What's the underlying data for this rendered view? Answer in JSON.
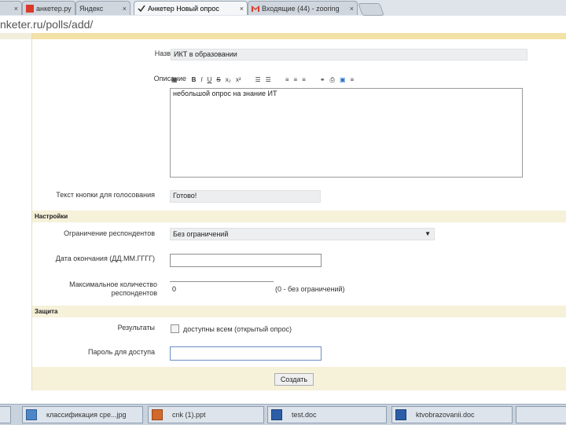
{
  "browser": {
    "tabs": [
      {
        "label": "анкетер.ру",
        "active": false
      },
      {
        "label": "Яндекс",
        "active": false
      },
      {
        "label": "Анкетер   Новый опрос",
        "active": true
      },
      {
        "label": "Входящие (44) - zooring",
        "active": false
      }
    ],
    "close_glyph": "×",
    "address": "nketer.ru/polls/add/"
  },
  "form": {
    "name_label": "Название",
    "name_value": "ИКТ в образовании",
    "description_label": "Описание",
    "toolbar": [
      "▦",
      "B",
      "I",
      "U",
      "S",
      "x₂",
      "x²",
      "☰",
      "☰",
      "≡",
      "≡",
      "≡",
      "⚭",
      "⎙",
      "▣",
      "≡"
    ],
    "description_value": "небольшой опрос на знание ИТ",
    "vote_button_label": "Текст кнопки для голосования",
    "vote_button_value": "Готово!",
    "settings_header": "Настройки",
    "restriction_label": "Ограничение респондентов",
    "restriction_value": "Без ограничений",
    "end_date_label": "Дата окончания (ДД.ММ.ГГГГ)",
    "end_date_value": "",
    "max_label": "Максимальное количество респондентов",
    "max_value": "0",
    "max_hint": "(0 - без ограничений)",
    "protection_header": "Защита",
    "results_label": "Результаты",
    "results_checkbox_label": "доступны всем (открытый опрос)",
    "password_label": "Пароль для доступа",
    "password_value": "",
    "submit_label": "Создать"
  },
  "taskbar": {
    "items": [
      {
        "label": "классификация сре...jpg"
      },
      {
        "label": "cnk (1).ppt"
      },
      {
        "label": "test.doc"
      },
      {
        "label": "ktvobrazovanii.doc"
      }
    ]
  },
  "colors": {
    "section_bg": "#f6f1d9",
    "header_bg": "#f3e2a8",
    "field_grey": "#eceeef"
  }
}
